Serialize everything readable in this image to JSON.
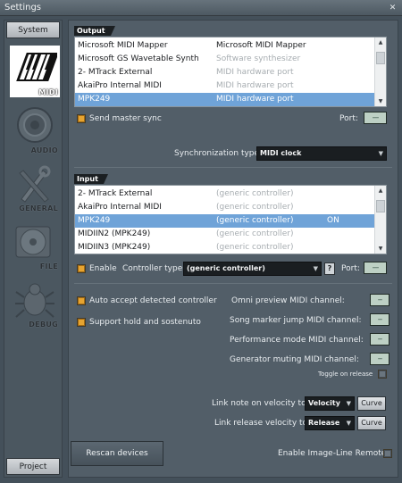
{
  "window": {
    "title": "Settings",
    "close_glyph": "✕"
  },
  "sidebar": {
    "top_button": "System",
    "bottom_button": "Project",
    "categories": [
      {
        "label": "MIDI",
        "icon": "midi-keys-icon",
        "active": true
      },
      {
        "label": "AUDIO",
        "icon": "speaker-icon",
        "active": false
      },
      {
        "label": "GENERAL",
        "icon": "tools-icon",
        "active": false
      },
      {
        "label": "FILE",
        "icon": "disc-icon",
        "active": false
      },
      {
        "label": "DEBUG",
        "icon": "bug-icon",
        "active": false
      }
    ]
  },
  "output": {
    "tag": "Output",
    "rows": [
      {
        "name": "Microsoft MIDI Mapper",
        "type": "Microsoft MIDI Mapper",
        "type_gray": false
      },
      {
        "name": "Microsoft GS Wavetable Synth",
        "type": "Software synthesizer",
        "type_gray": true
      },
      {
        "name": "2- MTrack External",
        "type": "MIDI hardware port",
        "type_gray": true
      },
      {
        "name": "AkaiPro Internal MIDI",
        "type": "MIDI hardware port",
        "type_gray": true
      },
      {
        "name": "MPK249",
        "type": "MIDI hardware port",
        "type_gray": true,
        "selected": true
      }
    ],
    "send_master_sync": "Send master sync",
    "port_label": "Port:",
    "port_value": "---",
    "sync_label": "Synchronization type:",
    "sync_value": "MIDI clock"
  },
  "input": {
    "tag": "Input",
    "rows": [
      {
        "name": "2- MTrack External",
        "type": "(generic controller)",
        "state": ""
      },
      {
        "name": "AkaiPro Internal MIDI",
        "type": "(generic controller)",
        "state": ""
      },
      {
        "name": "MPK249",
        "type": "(generic controller)",
        "state": "ON",
        "selected": true
      },
      {
        "name": "MIDIIN2 (MPK249)",
        "type": "(generic controller)",
        "state": ""
      },
      {
        "name": "MIDIIN3 (MPK249)",
        "type": "(generic controller)",
        "state": ""
      }
    ],
    "enable_label": "Enable",
    "controller_type_label": "Controller type:",
    "controller_type_value": "(generic controller)",
    "help_glyph": "?",
    "port_label": "Port:",
    "port_value": "---"
  },
  "options": {
    "auto_accept": "Auto accept detected controller",
    "support_hold": "Support hold and sostenuto",
    "omni_preview": "Omni preview MIDI channel:",
    "song_marker": "Song marker jump MIDI channel:",
    "performance_mode": "Performance mode MIDI channel:",
    "generator_muting": "Generator muting MIDI channel:",
    "channel_value": "--",
    "toggle_on_release": "Toggle on release",
    "link_note_label": "Link note on velocity to:",
    "link_note_value": "Velocity",
    "link_release_label": "Link release velocity to:",
    "link_release_value": "Release",
    "curve_label": "Curve"
  },
  "footer": {
    "rescan": "Rescan devices",
    "enable_remote": "Enable Image-Line Remote"
  }
}
